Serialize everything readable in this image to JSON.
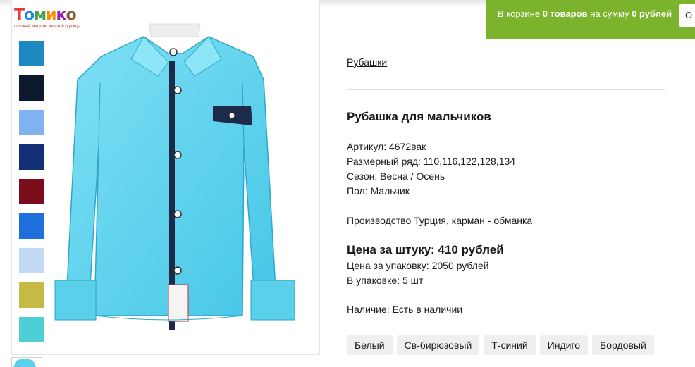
{
  "brand": {
    "logo_text": "Томико",
    "tagline": "оптовый магазин детской одежды"
  },
  "gallery": {
    "swatches": [
      {
        "color": "#1e88c2"
      },
      {
        "color": "#0d1a2e"
      },
      {
        "color": "#7fb2ee"
      },
      {
        "color": "#132f76"
      },
      {
        "color": "#7a0c1c"
      },
      {
        "color": "#1f6fdc"
      },
      {
        "color": "#c3daf5"
      },
      {
        "color": "#c6ba46"
      },
      {
        "color": "#4ecfd6"
      }
    ]
  },
  "cart": {
    "prefix": "В корзине ",
    "count": "0 товаров",
    "middle": " на сумму ",
    "sum": "0 рублей",
    "button_label": "О"
  },
  "breadcrumb": "Рубашки",
  "product": {
    "title": "Рубашка для мальчиков",
    "article": "Артикул: 4672вак",
    "sizes": "Размерный ряд: 110,116,122,128,134",
    "season": "Сезон: Весна / Осень",
    "gender": "Пол: Мальчик",
    "description": "Производство Турция, карман - обманка",
    "price_unit": "Цена за штуку: 410 рублей",
    "price_pack": "Цена за упаковку: 2050 рублей",
    "pack_qty": "В упаковке: 5 шт",
    "availability": "Наличие: Есть в наличии"
  },
  "colors": [
    "Белый",
    "Св-бирюзовый",
    "Т-синий",
    "Индиго",
    "Бордовый"
  ]
}
